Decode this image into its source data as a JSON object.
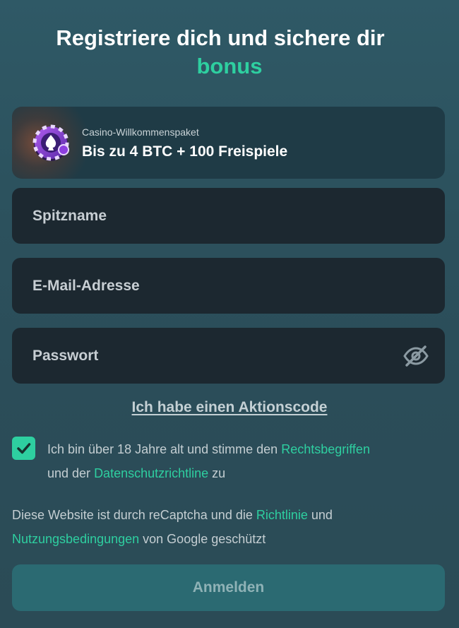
{
  "header": {
    "title_line1": "Registriere dich und sichere dir",
    "title_line2": "bonus"
  },
  "promo": {
    "label": "Casino-Willkommenspaket",
    "offer": "Bis zu 4 BTC + 100 Freispiele",
    "icon": "casino-chip-icon"
  },
  "form": {
    "nickname_placeholder": "Spitzname",
    "nickname_value": "",
    "email_placeholder": "E-Mail-Adresse",
    "email_value": "",
    "password_placeholder": "Passwort",
    "password_value": "",
    "password_toggle_icon": "eye-off-icon",
    "promo_code_link": "Ich habe einen Aktionscode"
  },
  "consent": {
    "checked": true,
    "text_before": "Ich bin über 18 Jahre alt und stimme den ",
    "terms_link": "Rechtsbegriffen",
    "text_middle": " und der ",
    "privacy_link": "Datenschutzrichtline",
    "text_after": " zu"
  },
  "recaptcha": {
    "text_before": "Diese Website ist durch reCaptcha und die ",
    "policy_link": "Richtlinie",
    "text_middle": " und ",
    "terms_link": "Nutzungsbedingungen",
    "text_after": " von Google geschützt"
  },
  "submit": {
    "label": "Anmelden"
  },
  "colors": {
    "accent": "#2ecfa0",
    "field_bg": "#1c2830",
    "button_bg": "#2b6a72"
  }
}
